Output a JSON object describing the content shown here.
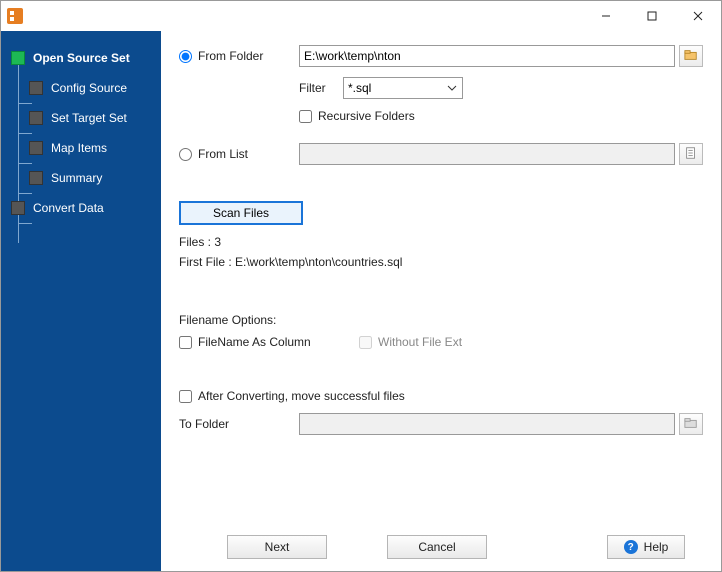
{
  "titlebar": {
    "title": ""
  },
  "sidebar": {
    "items": [
      {
        "label": "Open Source Set"
      },
      {
        "label": "Config Source"
      },
      {
        "label": "Set Target Set"
      },
      {
        "label": "Map Items"
      },
      {
        "label": "Summary"
      },
      {
        "label": "Convert Data"
      }
    ]
  },
  "main": {
    "from_folder_label": "From Folder",
    "from_folder_value": "E:\\work\\temp\\nton",
    "filter_label": "Filter",
    "filter_value": "*.sql",
    "recursive_label": "Recursive Folders",
    "from_list_label": "From List",
    "from_list_value": "",
    "scan_button": "Scan Files",
    "files_count_label": "Files : 3",
    "first_file_label": "First File : E:\\work\\temp\\nton\\countries.sql",
    "filename_options_heading": "Filename Options:",
    "filename_as_column_label": "FileName As Column",
    "without_ext_label": "Without File Ext",
    "after_converting_label": "After Converting, move successful files",
    "to_folder_label": "To Folder",
    "to_folder_value": ""
  },
  "footer": {
    "next": "Next",
    "cancel": "Cancel",
    "help": "Help"
  }
}
